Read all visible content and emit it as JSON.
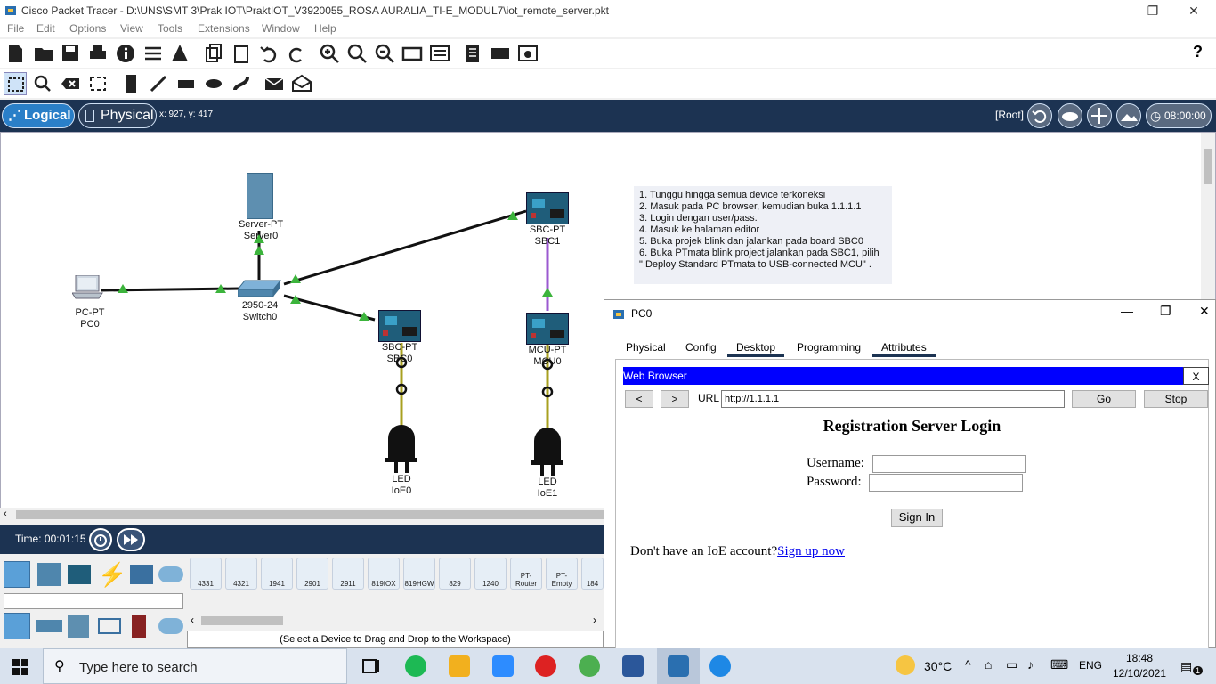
{
  "window": {
    "title": "Cisco Packet Tracer - D:\\UNS\\SMT 3\\Prak IOT\\PraktIOT_V3920055_ROSA AURALIA_TI-E_MODUL7\\iot_remote_server.pkt",
    "minimize": "—",
    "restore": "❐",
    "close": "✕"
  },
  "menu": [
    "File",
    "Edit",
    "Options",
    "View",
    "Tools",
    "Extensions",
    "Window",
    "Help"
  ],
  "help_symbol": "?",
  "navbar": {
    "logical_label": "Logical",
    "physical_label": "Physical",
    "coords": "x: 927, y: 417",
    "root_label": "[Root]",
    "clock": "08:00:00"
  },
  "devices": {
    "server": {
      "type": "Server-PT",
      "name": "Server0"
    },
    "pc": {
      "type": "PC-PT",
      "name": "PC0"
    },
    "switch": {
      "type": "2950-24",
      "name": "Switch0"
    },
    "sbc0": {
      "type": "SBC-PT",
      "name": "SBC0"
    },
    "sbc1": {
      "type": "SBC-PT",
      "name": "SBC1"
    },
    "mcu": {
      "type": "MCU-PT",
      "name": "MCU0"
    },
    "led0": {
      "type": "LED",
      "name": "IoE0"
    },
    "led1": {
      "type": "LED",
      "name": "IoE1"
    }
  },
  "note_lines": [
    "1. Tunggu hingga semua device terkoneksi",
    "2. Masuk pada PC browser, kemudian buka 1.1.1.1",
    "3. Login dengan user/pass.",
    "4. Masuk ke halaman editor",
    "5. Buka projek blink dan jalankan pada board SBC0",
    "6. Buka PTmata blink project jalankan pada SBC1, pilih",
    "\" Deploy Standard PTmata to USB-connected MCU\" ."
  ],
  "time": {
    "label": "Time: 00:01:15"
  },
  "device_models": [
    "4331",
    "4321",
    "1941",
    "2901",
    "2911",
    "819IOX",
    "819HGW",
    "829",
    "1240",
    "PT-Router",
    "PT-Empty",
    "184"
  ],
  "device_hint": "(Select a Device to Drag and Drop to the Workspace)",
  "pc_window": {
    "title": "PC0",
    "tabs": [
      "Physical",
      "Config",
      "Desktop",
      "Programming",
      "Attributes"
    ],
    "active_tab": "Desktop",
    "browser": {
      "title": "Web Browser",
      "close": "X",
      "back": "<",
      "forward": ">",
      "url_label": "URL",
      "url": "http://1.1.1.1",
      "go": "Go",
      "stop": "Stop",
      "heading": "Registration Server Login",
      "username_label": "Username:",
      "password_label": "Password:",
      "signin": "Sign In",
      "no_account": "Don't have an IoE account?",
      "signup": "Sign up now"
    }
  },
  "taskbar": {
    "search_placeholder": "Type here to search",
    "weather": "30°C",
    "lang": "ENG",
    "time": "18:48",
    "date": "12/10/2021",
    "notif_count": "1"
  },
  "colors": {
    "navbar": "#1c3352",
    "browser_bar": "#0000ff",
    "link_green": "#22aa22",
    "link_purple": "#9b59d0"
  }
}
